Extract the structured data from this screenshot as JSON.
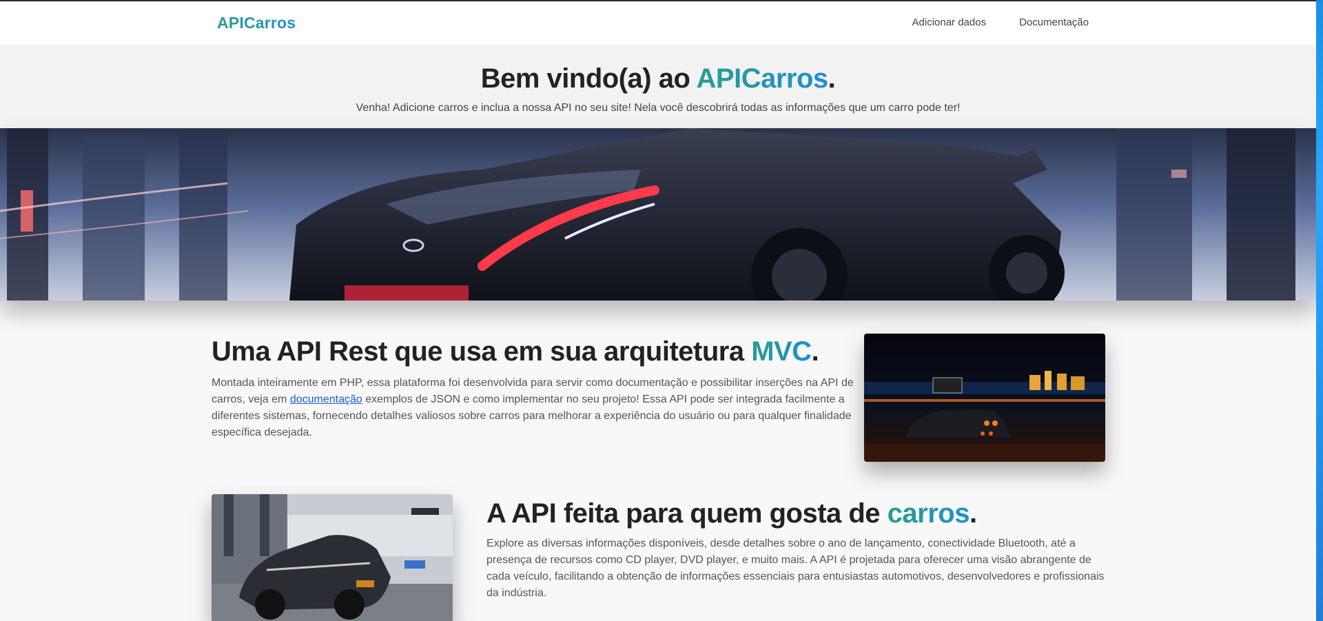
{
  "nav": {
    "brand": "APICarros",
    "links": [
      "Adicionar dados",
      "Documentação"
    ]
  },
  "hero": {
    "title_prefix": "Bem vindo(a) ao ",
    "title_accent": "APICarros",
    "title_suffix": ".",
    "subtitle": "Venha! Adicione carros e inclua a nossa API no seu site! Nela você descobrirá todas as informações que um carro pode ter!"
  },
  "section1": {
    "title_prefix": "Uma API Rest que usa em sua arquitetura ",
    "title_accent": "MVC",
    "title_suffix": ".",
    "body_before": "Montada inteiramente em PHP, essa plataforma foi desenvolvida para servir como documentação e possibilitar inserções na API de carros, veja em ",
    "link": "documentação",
    "body_after": " exemplos de JSON e como implementar no seu projeto! Essa API pode ser integrada facilmente a diferentes sistemas, fornecendo detalhes valiosos sobre carros para melhorar a experiência do usuário ou para qualquer finalidade específica desejada."
  },
  "section2": {
    "title_prefix": "A API feita para quem gosta de ",
    "title_accent": "carros",
    "title_suffix": ".",
    "body": "Explore as diversas informações disponíveis, desde detalhes sobre o ano de lançamento, conectividade Bluetooth, até a presença de recursos como CD player, DVD player, e muito mais. A API é projetada para oferecer uma visão abrangente de cada veículo, facilitando a obtenção de informações essenciais para entusiastas automotivos, desenvolvedores e profissionais da indústria."
  },
  "colors": {
    "accent_start": "#2a9d8f",
    "accent_end": "#1f8fcf",
    "link": "#1a5fd6"
  }
}
